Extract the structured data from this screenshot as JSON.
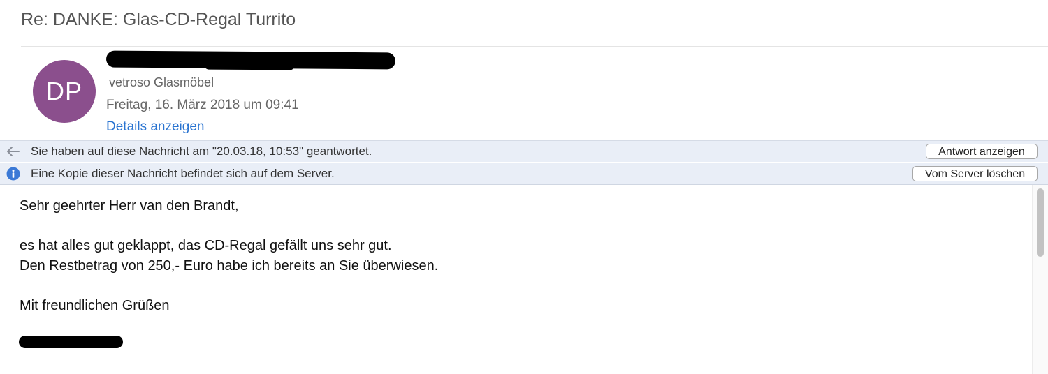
{
  "message": {
    "subject": "Re: DANKE: Glas-CD-Regal Turrito",
    "sender": {
      "initials": "DP",
      "avatar_color": "#8b4f8d",
      "organization": "vetroso Glasmöbel",
      "date": "Freitag, 16. März 2018 um 09:41",
      "details_link": "Details anzeigen"
    },
    "notices": {
      "replied": {
        "icon": "back-arrow-icon",
        "text": "Sie haben auf diese Nachricht am \"20.03.18, 10:53\" geantwortet.",
        "button": "Antwort anzeigen"
      },
      "server_copy": {
        "icon": "info-icon",
        "text": "Eine Kopie dieser Nachricht befindet sich auf dem Server.",
        "button": "Vom Server löschen"
      }
    },
    "body": {
      "greeting": "Sehr geehrter Herr van den Brandt,",
      "line1": "es hat alles gut geklappt, das CD-Regal gefällt uns sehr gut.",
      "line2": "Den Restbetrag von 250,- Euro habe ich bereits an Sie überwiesen.",
      "closing": "Mit freundlichen Grüßen"
    }
  },
  "colors": {
    "link": "#2a74d1",
    "notice_bar": "#e9eef7",
    "info_icon": "#3b79d6"
  }
}
